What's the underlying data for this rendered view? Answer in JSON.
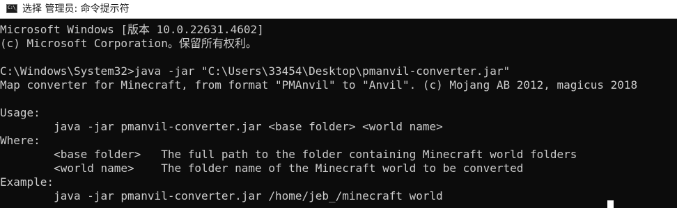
{
  "window": {
    "title": "选择 管理员: 命令提示符",
    "icon": "cmd-icon",
    "icon_text": "C:\\_"
  },
  "console": {
    "lines": [
      "Microsoft Windows [版本 10.0.22631.4602]",
      "(c) Microsoft Corporation。保留所有权利。",
      "",
      "C:\\Windows\\System32>java -jar \"C:\\Users\\33454\\Desktop\\pmanvil-converter.jar\"",
      "Map converter for Minecraft, from format \"PMAnvil\" to \"Anvil\". (c) Mojang AB 2012, magicus 2018",
      "",
      "Usage:",
      "        java -jar pmanvil-converter.jar <base folder> <world name>",
      "Where:",
      "        <base folder>   The full path to the folder containing Minecraft world folders",
      "        <world name>    The folder name of the Minecraft world to be converted",
      "Example:",
      "        java -jar pmanvil-converter.jar /home/jeb_/minecraft world"
    ]
  },
  "colors": {
    "background": "#0c0c0c",
    "foreground": "#cccccc",
    "titlebar": "#ffffff",
    "cursor": "#ffffff"
  }
}
